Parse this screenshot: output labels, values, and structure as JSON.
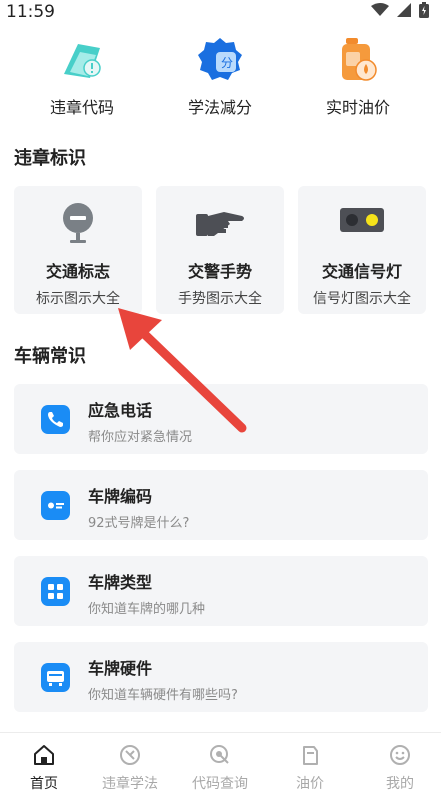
{
  "status_bar": {
    "time": "11:59"
  },
  "quick_tools": [
    {
      "label": "违章代码",
      "icon": "violation-code-icon"
    },
    {
      "label": "学法减分",
      "icon": "study-deduct-icon",
      "badge": "分"
    },
    {
      "label": "实时油价",
      "icon": "oil-price-icon"
    }
  ],
  "sections": {
    "violation_signs": "违章标识",
    "vehicle_knowledge": "车辆常识"
  },
  "sign_cards": [
    {
      "title": "交通标志",
      "subtitle": "标示图示大全",
      "icon": "traffic-sign-icon"
    },
    {
      "title": "交警手势",
      "subtitle": "手势图示大全",
      "icon": "police-gesture-icon"
    },
    {
      "title": "交通信号灯",
      "subtitle": "信号灯图示大全",
      "icon": "traffic-light-icon"
    }
  ],
  "knowledge": [
    {
      "title": "应急电话",
      "desc": "帮你应对紧急情况",
      "icon": "phone-icon"
    },
    {
      "title": "车牌编码",
      "desc": "92式号牌是什么?",
      "icon": "plate-code-icon"
    },
    {
      "title": "车牌类型",
      "desc": "你知道车牌的哪几种",
      "icon": "plate-type-icon"
    },
    {
      "title": "车牌硬件",
      "desc": "你知道车辆硬件有哪些吗?",
      "icon": "plate-hardware-icon"
    }
  ],
  "bottom_nav": [
    {
      "label": "首页",
      "icon": "home-icon",
      "active": true
    },
    {
      "label": "违章学法",
      "icon": "study-icon",
      "active": false
    },
    {
      "label": "代码查询",
      "icon": "code-search-icon",
      "active": false
    },
    {
      "label": "油价",
      "icon": "fuel-icon",
      "active": false
    },
    {
      "label": "我的",
      "icon": "profile-icon",
      "active": false
    }
  ],
  "colors": {
    "accent_blue": "#1a8cf5",
    "card_bg": "#f4f5f7",
    "annotation_red": "#e8453c",
    "teal": "#3fc6c2",
    "orange": "#f28b2c"
  }
}
